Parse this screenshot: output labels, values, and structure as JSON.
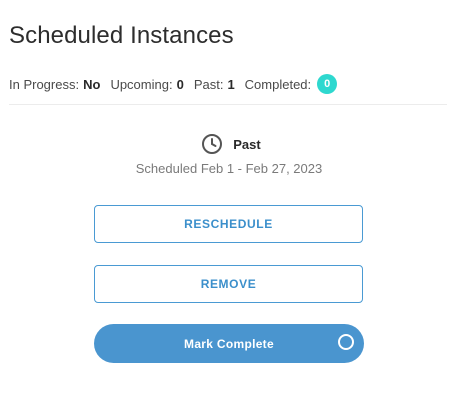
{
  "header": {
    "title": "Scheduled Instances"
  },
  "stats": {
    "in_progress_label": "In Progress:",
    "in_progress_value": "No",
    "upcoming_label": "Upcoming:",
    "upcoming_value": "0",
    "past_label": "Past:",
    "past_value": "1",
    "completed_label": "Completed:",
    "completed_value": "0"
  },
  "instance": {
    "icon": "clock-icon",
    "status": "Past",
    "schedule_text": "Scheduled Feb 1 - Feb 27, 2023"
  },
  "actions": {
    "reschedule_label": "RESCHEDULE",
    "remove_label": "REMOVE",
    "mark_complete_label": "Mark Complete",
    "mark_complete_icon": "circle-toggle-icon"
  },
  "colors": {
    "accent": "#4a95cf",
    "badge": "#2ed8cf",
    "button_text": "#3b8fcb"
  }
}
